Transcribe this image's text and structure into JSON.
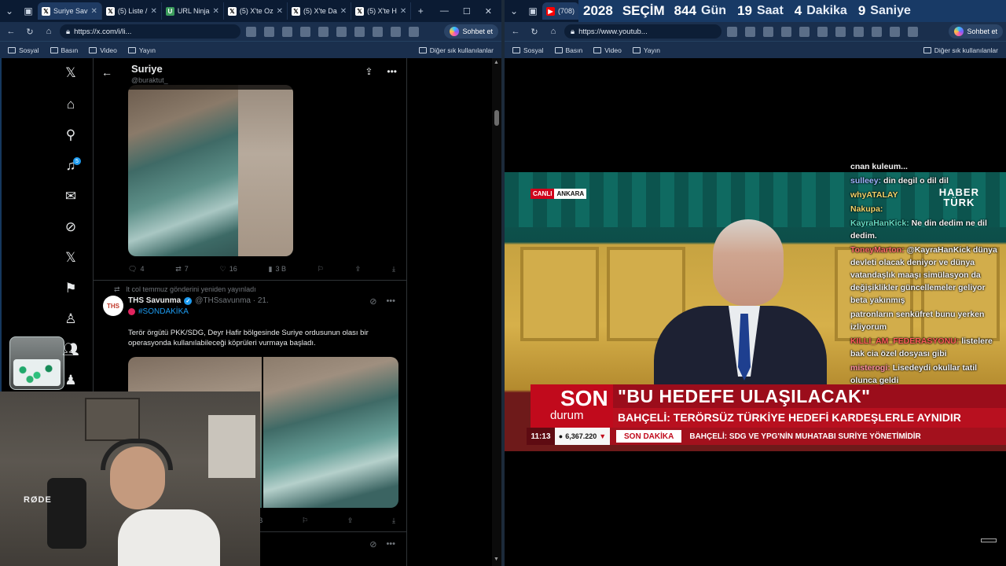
{
  "left": {
    "tabs": [
      {
        "label": "Suriye Sav",
        "fav": "X"
      },
      {
        "label": "(5) Liste /",
        "fav": "X"
      },
      {
        "label": "URL Ninja",
        "fav": "U"
      },
      {
        "label": "(5) X'te Oz",
        "fav": "X"
      },
      {
        "label": "(5) X'te Da",
        "fav": "X"
      },
      {
        "label": "(5) X'te H",
        "fav": "X"
      }
    ],
    "url": "https://x.com/i/li...",
    "sohbet": "Sohbet et",
    "bookmarks": [
      "Sosyal",
      "Basın",
      "Video",
      "Yayın"
    ],
    "bookmarks_right": "Diğer sık kullanılanlar",
    "notif_count": "5",
    "header": {
      "title": "Suriye",
      "handle": "@buraktut_"
    },
    "post1": {
      "replies": "4",
      "reposts": "7",
      "likes": "16",
      "views": "3 B"
    },
    "post2": {
      "repost_note": "lt col temmuz gönderini yeniden yayınladı",
      "name": "THS Savunma",
      "handle": "@THSsavunma · 21.",
      "hashtag": "#SONDAKİKA",
      "text": "Terör örgütü PKK/SDG, Deyr Hafir bölgesinde Suriye ordusunun olası bir operasyonda kullanılabileceği köprüleri vurmaya başladı.",
      "views": "3 B"
    },
    "webcam_brand": "RØDE",
    "avatar_text": "THS"
  },
  "right": {
    "tab_count": "(708)",
    "banner": {
      "year": "2028",
      "secim": "SEÇİM",
      "days": "844",
      "days_u": "Gün",
      "hours": "19",
      "hours_u": "Saat",
      "mins": "4",
      "mins_u": "Dakika",
      "secs": "9",
      "secs_u": "Saniye"
    },
    "url": "https://www.youtub...",
    "sohbet": "Sohbet et",
    "bookmarks": [
      "Sosyal",
      "Basın",
      "Video",
      "Yayın"
    ],
    "bookmarks_right": "Diğer sık kullanılanlar",
    "tv": {
      "canli": "CANLI",
      "city": "ANKARA",
      "logo1": "HABER",
      "logo2": "TÜRK",
      "son": "SON",
      "durum": "durum",
      "headline": "\"BU HEDEFE ULAŞILACAK\"",
      "subline": "BAHÇELİ: TERÖRSÜZ TÜRKİYE HEDEFİ KARDEŞLERLE AYNIDIR",
      "time": "11:13",
      "bist": "6,367.220",
      "sondakika": "SON DAKİKA",
      "ticker": "BAHÇELİ: SDG VE YPG'NİN MUHATABI SURİYE YÖNETİMİDİR"
    },
    "chat": [
      {
        "name": "",
        "msg": "cnan kuleum..."
      },
      {
        "name": "sulleey:",
        "msg": "din degil o dil dil",
        "color": "#9fb4ff"
      },
      {
        "name": "whyATALAY",
        "msg": "",
        "color": "#f2d46b"
      },
      {
        "name": "Nakupa:",
        "msg": "",
        "color": "#f2d46b"
      },
      {
        "name": "KayraHanKick:",
        "msg": "Ne din dedim ne dil dedim.",
        "color": "#66d9c2"
      },
      {
        "name": "ToneyMarton:",
        "msg": "@KayraHanKick dünya devleti olacak deniyor ve dünya vatandaşlık maaşı simülasyon da değişiklikler güncellemeler geliyor beta yakınmış",
        "color": "#ff6b6b"
      },
      {
        "name": "",
        "msg": "patronların senküfret bunu yerken izliyorum"
      },
      {
        "name": "KILLI_AM_FEDERASYONU:",
        "msg": "listelere bak cia özel dosyası gibi",
        "color": "#ff5a5a"
      },
      {
        "name": "misterogi:",
        "msg": "Lisedeydi okullar tatil olunca geldi",
        "color": "#ff8fa3"
      }
    ]
  }
}
